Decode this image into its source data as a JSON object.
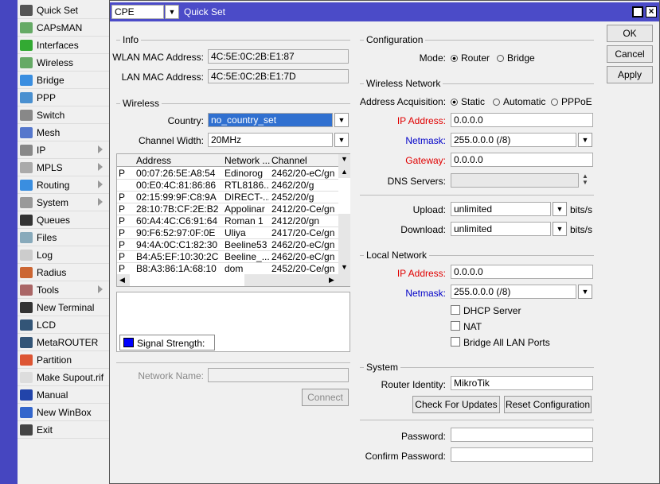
{
  "sidebar": {
    "items": [
      {
        "label": "Quick Set",
        "icon": "quick-set-icon",
        "color": "#555",
        "sub": false
      },
      {
        "label": "CAPsMAN",
        "icon": "antenna-icon",
        "color": "#6a6",
        "sub": false
      },
      {
        "label": "Interfaces",
        "icon": "interfaces-icon",
        "color": "#3a3",
        "sub": false
      },
      {
        "label": "Wireless",
        "icon": "antenna-icon",
        "color": "#6a6",
        "sub": false
      },
      {
        "label": "Bridge",
        "icon": "bridge-icon",
        "color": "#3a8ee0",
        "sub": false
      },
      {
        "label": "PPP",
        "icon": "ppp-icon",
        "color": "#4a90d0",
        "sub": false
      },
      {
        "label": "Switch",
        "icon": "switch-icon",
        "color": "#888",
        "sub": false
      },
      {
        "label": "Mesh",
        "icon": "mesh-icon",
        "color": "#5577cc",
        "sub": false
      },
      {
        "label": "IP",
        "icon": "ip-icon",
        "color": "#888",
        "sub": true
      },
      {
        "label": "MPLS",
        "icon": "mpls-icon",
        "color": "#aaa",
        "sub": true
      },
      {
        "label": "Routing",
        "icon": "routing-icon",
        "color": "#3a8ee0",
        "sub": true
      },
      {
        "label": "System",
        "icon": "gear-icon",
        "color": "#999",
        "sub": true
      },
      {
        "label": "Queues",
        "icon": "queues-icon",
        "color": "#333",
        "sub": false
      },
      {
        "label": "Files",
        "icon": "folder-icon",
        "color": "#8ab",
        "sub": false
      },
      {
        "label": "Log",
        "icon": "log-icon",
        "color": "#ccc",
        "sub": false
      },
      {
        "label": "Radius",
        "icon": "radius-icon",
        "color": "#c63",
        "sub": false
      },
      {
        "label": "Tools",
        "icon": "tools-icon",
        "color": "#a66",
        "sub": true
      },
      {
        "label": "New Terminal",
        "icon": "terminal-icon",
        "color": "#333",
        "sub": false
      },
      {
        "label": "LCD",
        "icon": "lcd-icon",
        "color": "#357",
        "sub": false
      },
      {
        "label": "MetaROUTER",
        "icon": "metarouter-icon",
        "color": "#357",
        "sub": false
      },
      {
        "label": "Partition",
        "icon": "partition-icon",
        "color": "#d53",
        "sub": false
      },
      {
        "label": "Make Supout.rif",
        "icon": "document-icon",
        "color": "#ddd",
        "sub": false
      },
      {
        "label": "Manual",
        "icon": "help-icon",
        "color": "#24a",
        "sub": false
      },
      {
        "label": "New WinBox",
        "icon": "winbox-icon",
        "color": "#36c",
        "sub": false
      },
      {
        "label": "Exit",
        "icon": "exit-icon",
        "color": "#444",
        "sub": false
      }
    ]
  },
  "window": {
    "mode_select": "CPE",
    "title": "Quick Set",
    "ok": "OK",
    "cancel": "Cancel",
    "apply": "Apply"
  },
  "info": {
    "title": "Info",
    "wlan_mac_label": "WLAN MAC Address:",
    "wlan_mac": "4C:5E:0C:2B:E1:87",
    "lan_mac_label": "LAN MAC Address:",
    "lan_mac": "4C:5E:0C:2B:E1:7D"
  },
  "wireless": {
    "title": "Wireless",
    "country_label": "Country:",
    "country": "no_country_set",
    "width_label": "Channel Width:",
    "width": "20MHz",
    "columns": [
      "Address",
      "Network ...",
      "Channel"
    ],
    "rows": [
      [
        "P",
        "00:07:26:5E:A8:54",
        "Edinorog",
        "2462/20-eC/gn"
      ],
      [
        "",
        "00:E0:4C:81:86:86",
        "RTL8186...",
        "2462/20/g"
      ],
      [
        "P",
        "02:15:99:9F:C8:9A",
        "DIRECT-...",
        "2452/20/g"
      ],
      [
        "P",
        "28:10:7B:CF:2E:B2",
        "Appolinar",
        "2412/20-Ce/gn"
      ],
      [
        "P",
        "60:A4:4C:C6:91:64",
        "Roman 1",
        "2412/20/gn"
      ],
      [
        "P",
        "90:F6:52:97:0F:0E",
        "Uliya",
        "2417/20-Ce/gn"
      ],
      [
        "P",
        "94:4A:0C:C1:82:30",
        "Beeline53",
        "2462/20-eC/gn"
      ],
      [
        "P",
        "B4:A5:EF:10:30:2C",
        "Beeline_...",
        "2462/20-eC/gn"
      ],
      [
        "P",
        "B8:A3:86:1A:68:10",
        "dom",
        "2452/20-Ce/gn"
      ]
    ],
    "signal_label": "Signal Strength:",
    "signal_color": "#0000ff",
    "network_name_label": "Network Name:",
    "network_name": "",
    "connect": "Connect"
  },
  "configuration": {
    "title": "Configuration",
    "mode_label": "Mode:",
    "mode_options": [
      "Router",
      "Bridge"
    ],
    "mode_selected": "Router"
  },
  "wireless_network": {
    "title": "Wireless Network",
    "acq_label": "Address Acquisition:",
    "acq_options": [
      "Static",
      "Automatic",
      "PPPoE"
    ],
    "acq_selected": "Static",
    "ip_label": "IP Address:",
    "ip": "0.0.0.0",
    "netmask_label": "Netmask:",
    "netmask": "255.0.0.0 (/8)",
    "gateway_label": "Gateway:",
    "gateway": "0.0.0.0",
    "dns_label": "DNS Servers:",
    "dns": "",
    "upload_label": "Upload:",
    "upload": "unlimited",
    "download_label": "Download:",
    "download": "unlimited",
    "unit": "bits/s"
  },
  "local_network": {
    "title": "Local Network",
    "ip_label": "IP Address:",
    "ip": "0.0.0.0",
    "netmask_label": "Netmask:",
    "netmask": "255.0.0.0 (/8)",
    "dhcp": "DHCP Server",
    "nat": "NAT",
    "bridge_lan": "Bridge All LAN Ports",
    "dhcp_checked": false,
    "nat_checked": false,
    "bridge_checked": false
  },
  "system": {
    "title": "System",
    "identity_label": "Router Identity:",
    "identity": "MikroTik",
    "check_updates": "Check For Updates",
    "reset": "Reset Configuration",
    "password_label": "Password:",
    "password": "",
    "confirm_label": "Confirm Password:",
    "confirm": ""
  }
}
